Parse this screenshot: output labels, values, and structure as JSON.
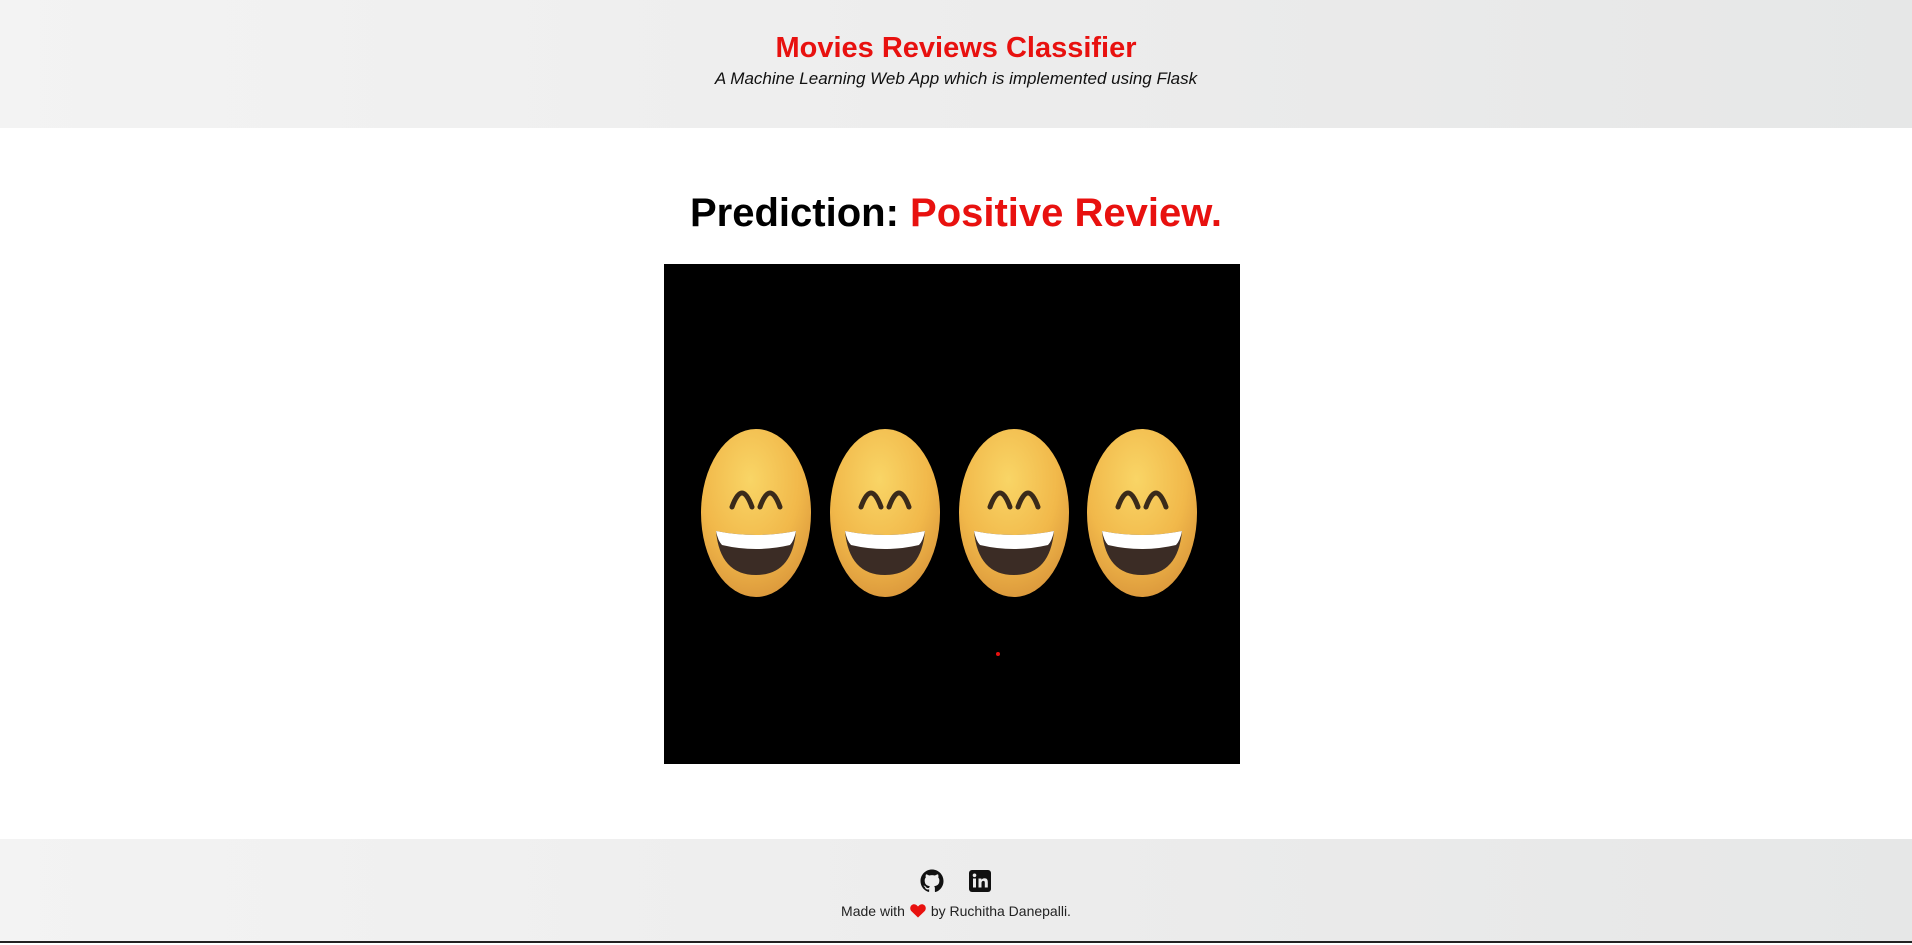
{
  "header": {
    "title": "Movies Reviews Classifier",
    "subtitle": "A Machine Learning Web App which is implemented using Flask"
  },
  "main": {
    "prediction_label": "Prediction:",
    "prediction_value": "Positive Review.",
    "image": {
      "icon": "grinning-face-emoji",
      "count": 4
    }
  },
  "footer": {
    "links": [
      {
        "icon": "github-icon"
      },
      {
        "icon": "linkedin-icon"
      }
    ],
    "credit_prefix": "Made with",
    "credit_suffix": "by Ruchitha Danepalli.",
    "heart_icon": "heart-icon"
  },
  "colors": {
    "accent": "#e8110f",
    "header_bg": "#ececec",
    "image_bg": "#000000",
    "emoji_face": "#f1b84a"
  }
}
